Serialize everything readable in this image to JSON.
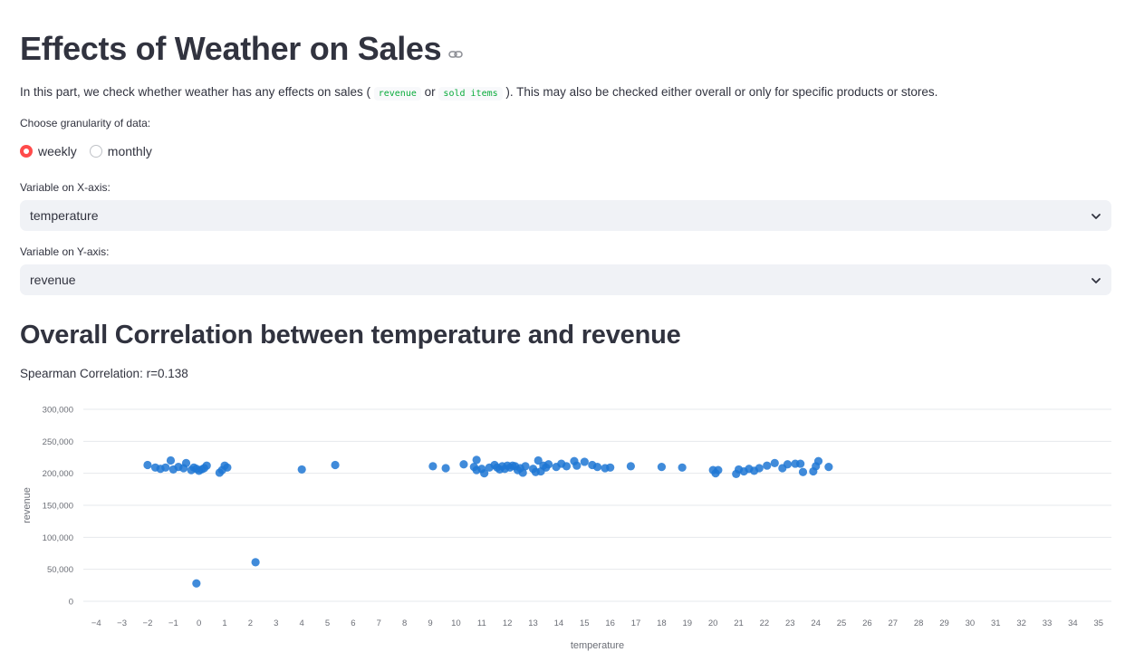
{
  "title": "Effects of Weather on Sales",
  "intro": {
    "before": "In this part, we check whether weather has any effects on sales (",
    "code1": "revenue",
    "mid": "or",
    "code2": "sold items",
    "after": "). This may also be checked either overall or only for specific products or stores."
  },
  "granularity": {
    "label": "Choose granularity of data:",
    "options": [
      "weekly",
      "monthly"
    ],
    "selected": "weekly"
  },
  "x_select": {
    "label": "Variable on X-axis:",
    "value": "temperature"
  },
  "y_select": {
    "label": "Variable on Y-axis:",
    "value": "revenue"
  },
  "section_title": "Overall Correlation between temperature and revenue",
  "correlation_text": "Spearman Correlation: r=0.138",
  "colors": {
    "accent": "#ff4b4b",
    "point": "#1f77d4",
    "code": "#09ab3b"
  },
  "icons": {
    "heading_link": "link-icon",
    "select_arrow": "chevron-down-icon"
  },
  "chart_data": {
    "type": "scatter",
    "xlabel": "temperature",
    "ylabel": "revenue",
    "xlim": [
      -4.5,
      35.5
    ],
    "ylim": [
      0,
      300000
    ],
    "x_ticks": [
      -4,
      -3,
      -2,
      -1,
      0,
      1,
      2,
      3,
      4,
      5,
      6,
      7,
      8,
      9,
      10,
      11,
      12,
      13,
      14,
      15,
      16,
      17,
      18,
      19,
      20,
      21,
      22,
      23,
      24,
      25,
      26,
      27,
      28,
      29,
      30,
      31,
      32,
      33,
      34,
      35
    ],
    "y_ticks": [
      0,
      50000,
      100000,
      150000,
      200000,
      250000,
      300000
    ],
    "y_tick_labels": [
      "0",
      "50,000",
      "100,000",
      "150,000",
      "200,000",
      "250,000",
      "300,000"
    ],
    "grid": "horizontal",
    "points": [
      [
        -2.0,
        213000
      ],
      [
        -1.7,
        209000
      ],
      [
        -1.5,
        207000
      ],
      [
        -1.3,
        209000
      ],
      [
        -1.1,
        220000
      ],
      [
        -1.0,
        206000
      ],
      [
        -0.8,
        210000
      ],
      [
        -0.6,
        208000
      ],
      [
        -0.5,
        216000
      ],
      [
        -0.3,
        205000
      ],
      [
        -0.2,
        209000
      ],
      [
        -0.1,
        207000
      ],
      [
        0.0,
        204000
      ],
      [
        0.1,
        206000
      ],
      [
        0.2,
        208000
      ],
      [
        0.3,
        212000
      ],
      [
        0.8,
        201000
      ],
      [
        0.9,
        205000
      ],
      [
        1.0,
        212000
      ],
      [
        1.1,
        209000
      ],
      [
        -0.1,
        28000
      ],
      [
        2.2,
        61000
      ],
      [
        4.0,
        206000
      ],
      [
        5.3,
        213000
      ],
      [
        9.1,
        211000
      ],
      [
        9.6,
        208000
      ],
      [
        10.3,
        214000
      ],
      [
        10.7,
        210000
      ],
      [
        10.8,
        221000
      ],
      [
        10.8,
        205000
      ],
      [
        11.0,
        207000
      ],
      [
        11.1,
        200000
      ],
      [
        11.3,
        209000
      ],
      [
        11.5,
        213000
      ],
      [
        11.6,
        209000
      ],
      [
        11.7,
        206000
      ],
      [
        11.8,
        211000
      ],
      [
        11.9,
        207000
      ],
      [
        12.0,
        212000
      ],
      [
        12.1,
        209000
      ],
      [
        12.2,
        212000
      ],
      [
        12.3,
        211000
      ],
      [
        12.4,
        205000
      ],
      [
        12.5,
        208000
      ],
      [
        12.6,
        201000
      ],
      [
        12.7,
        211000
      ],
      [
        13.0,
        207000
      ],
      [
        13.1,
        202000
      ],
      [
        13.2,
        220000
      ],
      [
        13.3,
        203000
      ],
      [
        13.4,
        212000
      ],
      [
        13.5,
        209000
      ],
      [
        13.6,
        214000
      ],
      [
        13.9,
        210000
      ],
      [
        14.1,
        215000
      ],
      [
        14.3,
        211000
      ],
      [
        14.6,
        219000
      ],
      [
        14.7,
        212000
      ],
      [
        15.0,
        218000
      ],
      [
        15.3,
        213000
      ],
      [
        15.5,
        210000
      ],
      [
        15.8,
        208000
      ],
      [
        16.0,
        209000
      ],
      [
        16.8,
        211000
      ],
      [
        18.0,
        210000
      ],
      [
        18.8,
        209000
      ],
      [
        20.0,
        205000
      ],
      [
        20.1,
        200000
      ],
      [
        20.2,
        205000
      ],
      [
        20.9,
        199000
      ],
      [
        21.0,
        206000
      ],
      [
        21.2,
        203000
      ],
      [
        21.4,
        207000
      ],
      [
        21.6,
        204000
      ],
      [
        21.8,
        208000
      ],
      [
        22.1,
        212000
      ],
      [
        22.4,
        216000
      ],
      [
        22.7,
        208000
      ],
      [
        22.9,
        214000
      ],
      [
        23.2,
        215000
      ],
      [
        23.5,
        202000
      ],
      [
        23.9,
        203000
      ],
      [
        24.1,
        219000
      ],
      [
        24.5,
        210000
      ],
      [
        23.4,
        215000
      ],
      [
        24.0,
        211000
      ]
    ]
  }
}
